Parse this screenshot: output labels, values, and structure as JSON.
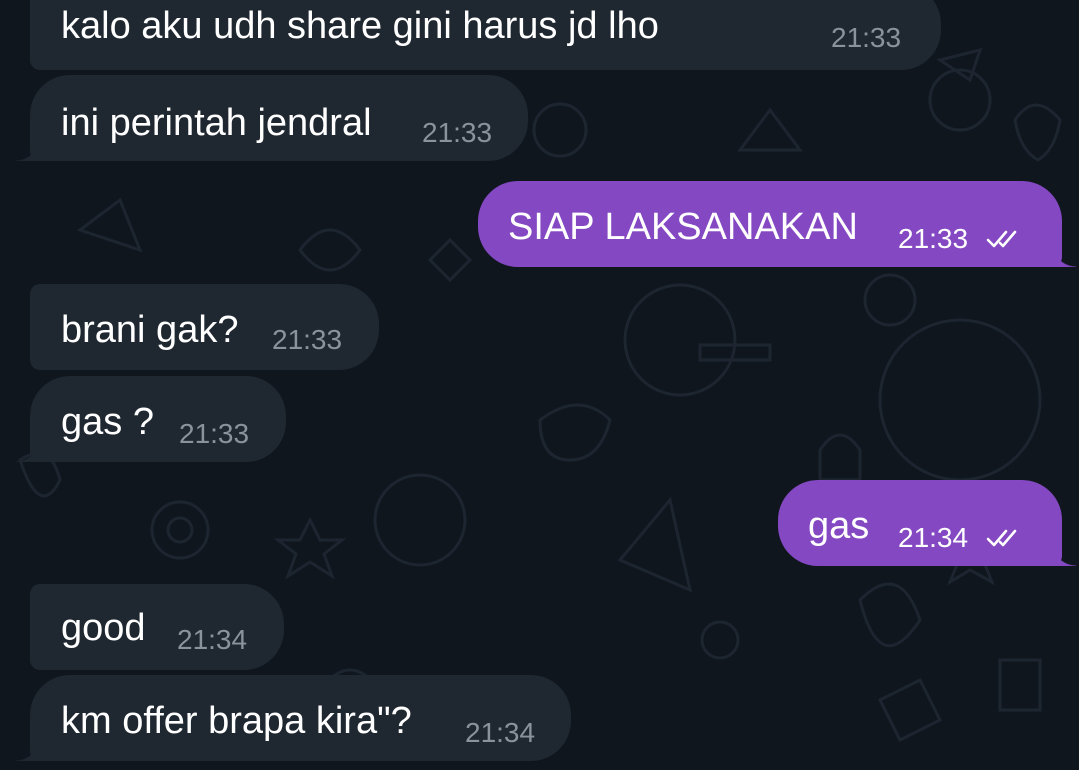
{
  "messages": [
    {
      "direction": "in",
      "text": "kalo aku udh share gini harus jd lho",
      "time": "21:33"
    },
    {
      "direction": "in",
      "text": "ini perintah jendral",
      "time": "21:33"
    },
    {
      "direction": "out",
      "text": "SIAP LAKSANAKAN",
      "time": "21:33",
      "status_icon": "double-check-icon"
    },
    {
      "direction": "in",
      "text": "brani gak?",
      "time": "21:33"
    },
    {
      "direction": "in",
      "text": "gas ?",
      "time": "21:33"
    },
    {
      "direction": "out",
      "text": "gas",
      "time": "21:34",
      "status_icon": "double-check-icon"
    },
    {
      "direction": "in",
      "text": "good",
      "time": "21:34"
    },
    {
      "direction": "in",
      "text": "km offer brapa kira\"?",
      "time": "21:34"
    }
  ],
  "colors": {
    "background": "#0f161e",
    "incoming_bubble": "#1f2730",
    "outgoing_bubble": "#8348c2",
    "incoming_time": "#8a939c",
    "outgoing_time": "#ffffff"
  }
}
